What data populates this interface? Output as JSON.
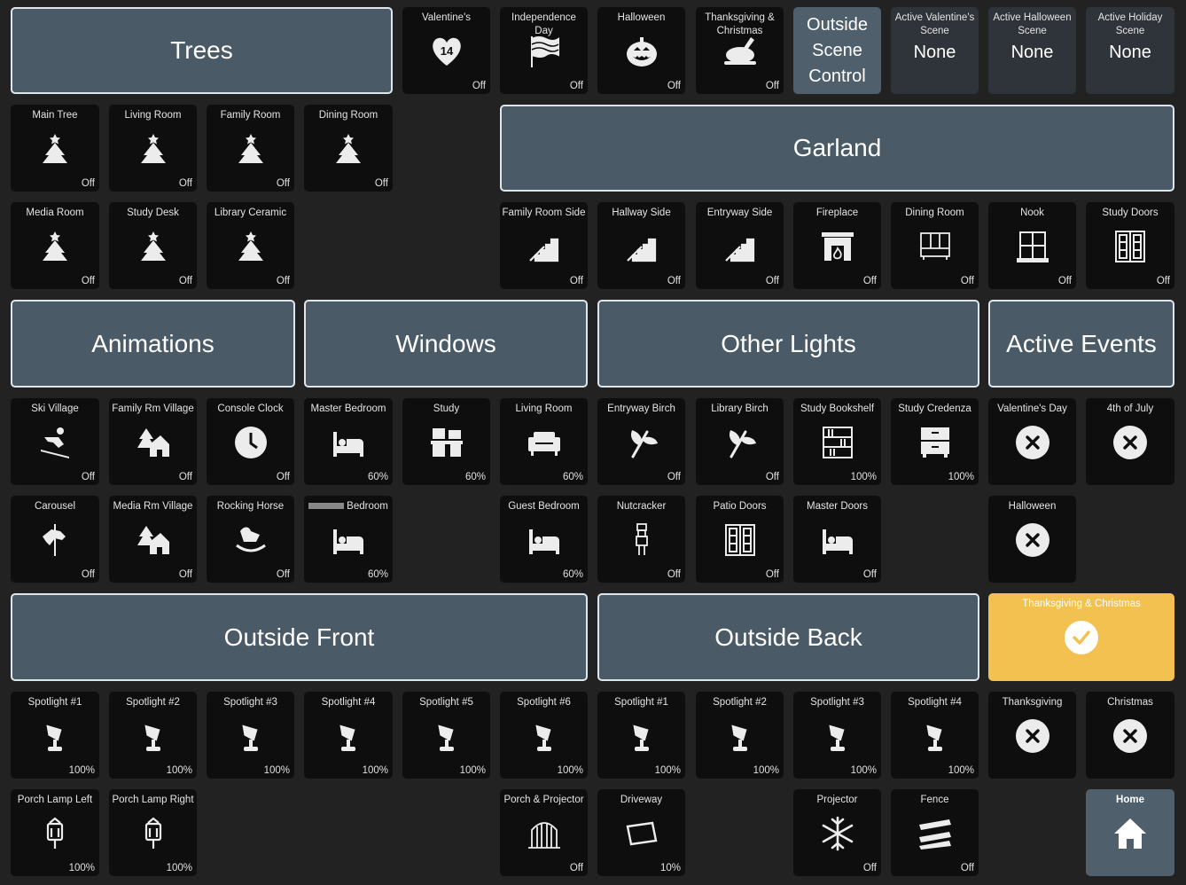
{
  "headers": {
    "trees": "Trees",
    "garland": "Garland",
    "animations": "Animations",
    "windows": "Windows",
    "other_lights": "Other Lights",
    "active_events": "Active Events",
    "outside_front": "Outside Front",
    "outside_back": "Outside Back"
  },
  "scene_control": {
    "label": "Outside Scene Control"
  },
  "holidays": [
    {
      "label": "Valentine's",
      "state": "Off",
      "icon": "heart-14-icon"
    },
    {
      "label": "Independence Day",
      "state": "Off",
      "icon": "flag-icon"
    },
    {
      "label": "Halloween",
      "state": "Off",
      "icon": "pumpkin-icon"
    },
    {
      "label": "Thanksgiving & Christmas",
      "state": "Off",
      "icon": "turkey-icon"
    }
  ],
  "active_scenes": [
    {
      "label": "Active Valentine's Scene",
      "value": "None"
    },
    {
      "label": "Active Halloween Scene",
      "value": "None"
    },
    {
      "label": "Active Holiday Scene",
      "value": "None"
    }
  ],
  "trees": [
    {
      "label": "Main Tree",
      "state": "Off"
    },
    {
      "label": "Living Room",
      "state": "Off"
    },
    {
      "label": "Family Room",
      "state": "Off"
    },
    {
      "label": "Dining Room",
      "state": "Off"
    },
    {
      "label": "Media Room",
      "state": "Off"
    },
    {
      "label": "Study Desk",
      "state": "Off"
    },
    {
      "label": "Library Ceramic",
      "state": "Off"
    }
  ],
  "garland": [
    {
      "label": "Family Room Side",
      "state": "Off",
      "icon": "stairs-icon"
    },
    {
      "label": "Hallway Side",
      "state": "Off",
      "icon": "stairs-icon"
    },
    {
      "label": "Entryway Side",
      "state": "Off",
      "icon": "stairs-icon"
    },
    {
      "label": "Fireplace",
      "state": "Off",
      "icon": "fireplace-icon"
    },
    {
      "label": "Dining Room",
      "state": "Off",
      "icon": "cabinet-icon"
    },
    {
      "label": "Nook",
      "state": "Off",
      "icon": "window-icon"
    },
    {
      "label": "Study Doors",
      "state": "Off",
      "icon": "door-icon"
    }
  ],
  "animations": [
    {
      "label": "Ski Village",
      "state": "Off",
      "icon": "skier-icon"
    },
    {
      "label": "Family Rm Village",
      "state": "Off",
      "icon": "village-icon"
    },
    {
      "label": "Console Clock",
      "state": "Off",
      "icon": "clock-icon"
    },
    {
      "label": "Carousel",
      "state": "Off",
      "icon": "carousel-icon"
    },
    {
      "label": "Media Rm Village",
      "state": "Off",
      "icon": "village-icon"
    },
    {
      "label": "Rocking Horse",
      "state": "Off",
      "icon": "rocking-horse-icon"
    }
  ],
  "windows": [
    {
      "label": "Master Bedroom",
      "state": "60%",
      "icon": "bed-icon"
    },
    {
      "label": "Study",
      "state": "60%",
      "icon": "desk-icon"
    },
    {
      "label": "Living Room",
      "state": "60%",
      "icon": "sofa-icon"
    },
    {
      "label": "Bedroom",
      "state": "60%",
      "icon": "bed-icon"
    },
    {
      "label": "Guest Bedroom",
      "state": "60%",
      "icon": "bed-icon"
    }
  ],
  "other_lights": [
    {
      "label": "Entryway Birch",
      "state": "Off",
      "icon": "branch-icon"
    },
    {
      "label": "Library Birch",
      "state": "Off",
      "icon": "branch-icon"
    },
    {
      "label": "Study Bookshelf",
      "state": "100%",
      "icon": "bookshelf-icon"
    },
    {
      "label": "Study Credenza",
      "state": "100%",
      "icon": "dresser-icon"
    },
    {
      "label": "Nutcracker",
      "state": "Off",
      "icon": "nutcracker-icon"
    },
    {
      "label": "Patio Doors",
      "state": "Off",
      "icon": "door-icon"
    },
    {
      "label": "Master Doors",
      "state": "Off",
      "icon": "bed-icon"
    }
  ],
  "events": [
    {
      "label": "Valentine's Day"
    },
    {
      "label": "4th of July"
    },
    {
      "label": "Halloween"
    },
    {
      "label": "Thanksgiving & Christmas"
    },
    {
      "label": "Thanksgiving"
    },
    {
      "label": "Christmas"
    }
  ],
  "outside_front": [
    {
      "label": "Spotlight #1",
      "state": "100%"
    },
    {
      "label": "Spotlight #2",
      "state": "100%"
    },
    {
      "label": "Spotlight #3",
      "state": "100%"
    },
    {
      "label": "Spotlight #4",
      "state": "100%"
    },
    {
      "label": "Spotlight #5",
      "state": "100%"
    },
    {
      "label": "Spotlight #6",
      "state": "100%"
    },
    {
      "label": "Porch Lamp Left",
      "state": "100%"
    },
    {
      "label": "Porch Lamp Right",
      "state": "100%"
    },
    {
      "label": "Porch & Projector",
      "state": "Off"
    }
  ],
  "outside_back": [
    {
      "label": "Spotlight #1",
      "state": "100%"
    },
    {
      "label": "Spotlight #2",
      "state": "100%"
    },
    {
      "label": "Spotlight #3",
      "state": "100%"
    },
    {
      "label": "Spotlight #4",
      "state": "100%"
    },
    {
      "label": "Driveway",
      "state": "10%"
    },
    {
      "label": "Projector",
      "state": "Off"
    },
    {
      "label": "Fence",
      "state": "Off"
    }
  ],
  "home": {
    "label": "Home"
  },
  "colors": {
    "background": "#222222",
    "tile": "#0e0e0e",
    "header": "#4a5a66",
    "active_event": "#f2c14f"
  }
}
